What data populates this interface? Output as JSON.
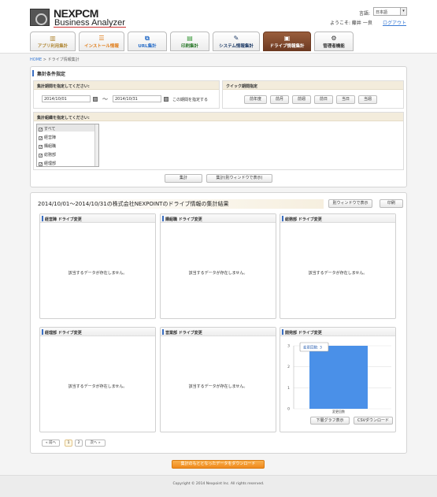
{
  "header": {
    "logo_name": "NEXPCM",
    "logo_sub": "Business Analyzer",
    "lang_label": "言語:",
    "lang_value": "日本語",
    "welcome": "ようこそ: 藤井 一良",
    "logout": "ログアウト"
  },
  "tabs": [
    {
      "label": "アプリ利用集計",
      "icon": "chart-icon"
    },
    {
      "label": "インストール情報",
      "icon": "list-icon"
    },
    {
      "label": "URL集計",
      "icon": "link-icon"
    },
    {
      "label": "印刷集計",
      "icon": "print-icon"
    },
    {
      "label": "システム情報集計",
      "icon": "edit-icon"
    },
    {
      "label": "ドライブ情報集計",
      "icon": "drive-icon"
    },
    {
      "label": "管理者機能",
      "icon": "gear-icon"
    }
  ],
  "active_tab_index": 5,
  "breadcrumb": {
    "home": "HOME",
    "sep": ">",
    "current": "ドライブ情報集計"
  },
  "conditions": {
    "title": "集計条件指定",
    "period_label": "集計期間を指定してください:",
    "date_from": "2014/10/01",
    "tilde": "～",
    "date_to": "2014/10/31",
    "period_note": "この期間を指定する",
    "quick_label": "クイック期間指定",
    "quick_buttons": [
      "前年度",
      "前月",
      "前週",
      "前日",
      "当日",
      "当週"
    ],
    "org_label": "集計組織を指定してください:",
    "orgs": [
      "すべて",
      "経営陣",
      "購組職",
      "総務部",
      "経理部"
    ],
    "btn_aggregate": "集計",
    "btn_aggregate_window": "集計(別ウィンドウで表示)"
  },
  "results": {
    "title": "2014/10/01～2014/10/31の株式会社NEXPOINTのドライブ情報の集計結果",
    "btn_window": "別ウィンドウで表示",
    "btn_print": "印刷",
    "no_data": "該当するデータが存在しません。",
    "cards": [
      {
        "title": "経営陣 ドライブ変更",
        "has_chart": false
      },
      {
        "title": "購組職 ドライブ変更",
        "has_chart": false
      },
      {
        "title": "総務部 ドライブ変更",
        "has_chart": false
      },
      {
        "title": "経理部 ドライブ変更",
        "has_chart": false
      },
      {
        "title": "営業部 ドライブ変更",
        "has_chart": false
      },
      {
        "title": "開発部 ドライブ変更",
        "has_chart": true
      }
    ],
    "chart_tooltip": "変更回数: 3",
    "btn_lower_graph": "下層グラフ表示",
    "btn_csv": "CSVダウンロード",
    "pagination": {
      "prev": "« 前へ",
      "pages": [
        "1",
        "2"
      ],
      "next": "次へ »"
    }
  },
  "download_button": "集計のもととなったデータをダウンロード",
  "copyright": "Copyright © 2014 Nexpoint Inc. All rights reserved.",
  "chart_data": {
    "type": "bar",
    "categories": [
      "変更回数"
    ],
    "values": [
      3
    ],
    "ylim": [
      0,
      3
    ],
    "yticks": [
      "0",
      "1",
      "2",
      "3"
    ],
    "color": "#4a90e8",
    "grid": true
  }
}
